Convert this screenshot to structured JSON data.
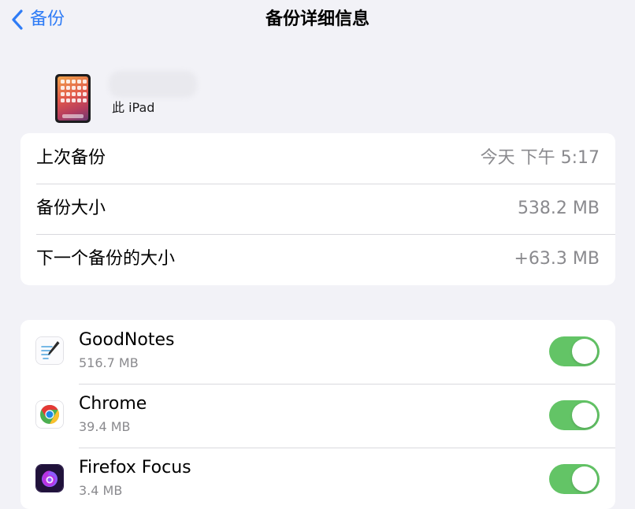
{
  "nav": {
    "back_label": "备份",
    "title": "备份详细信息"
  },
  "device": {
    "subtitle": "此 iPad",
    "icon": "ipad-icon"
  },
  "backup_info": [
    {
      "label": "上次备份",
      "value": "今天 下午 5:17"
    },
    {
      "label": "备份大小",
      "value": "538.2 MB"
    },
    {
      "label": "下一个备份的大小",
      "value": "+63.3 MB"
    }
  ],
  "apps": [
    {
      "name": "GoodNotes",
      "size": "516.7 MB",
      "icon": "goodnotes-icon",
      "enabled": true
    },
    {
      "name": "Chrome",
      "size": "39.4 MB",
      "icon": "chrome-icon",
      "enabled": true
    },
    {
      "name": "Firefox Focus",
      "size": "3.4 MB",
      "icon": "firefox-focus-icon",
      "enabled": true
    }
  ],
  "colors": {
    "accent": "#2f7cf6",
    "toggle_on": "#63c466",
    "background": "#f2f2f7",
    "secondary_text": "#8a8a8e"
  }
}
